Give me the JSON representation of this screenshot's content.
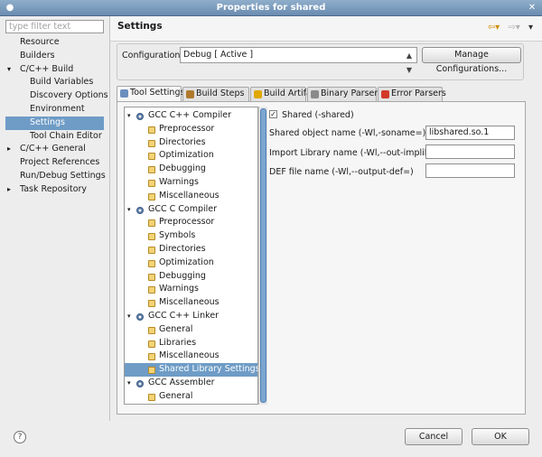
{
  "window": {
    "title": "Properties for shared"
  },
  "filter": {
    "placeholder": "type filter text"
  },
  "nav": {
    "items": [
      {
        "label": "Resource",
        "indent": 1,
        "arrow": ""
      },
      {
        "label": "Builders",
        "indent": 1,
        "arrow": ""
      },
      {
        "label": "C/C++ Build",
        "indent": 1,
        "arrow": "▾"
      },
      {
        "label": "Build Variables",
        "indent": 2,
        "arrow": ""
      },
      {
        "label": "Discovery Options",
        "indent": 2,
        "arrow": ""
      },
      {
        "label": "Environment",
        "indent": 2,
        "arrow": ""
      },
      {
        "label": "Settings",
        "indent": 2,
        "arrow": "",
        "selected": true
      },
      {
        "label": "Tool Chain Editor",
        "indent": 2,
        "arrow": ""
      },
      {
        "label": "C/C++ General",
        "indent": 1,
        "arrow": "▸"
      },
      {
        "label": "Project References",
        "indent": 1,
        "arrow": ""
      },
      {
        "label": "Run/Debug Settings",
        "indent": 1,
        "arrow": ""
      },
      {
        "label": "Task Repository",
        "indent": 1,
        "arrow": "▸"
      }
    ]
  },
  "header": {
    "title": "Settings",
    "back_icon": "⇦▾",
    "forward_icon": "⇨▾",
    "menu_icon": "▾"
  },
  "configuration": {
    "label": "Configuration:",
    "value": "Debug  [ Active ]",
    "manage_label": "Manage Configurations..."
  },
  "tabs": [
    {
      "label": "Tool Settings",
      "color": "#6b8fbd",
      "active": true
    },
    {
      "label": "Build Steps",
      "color": "#b0782c"
    },
    {
      "label": "Build Artifact",
      "color": "#e0a800"
    },
    {
      "label": "Binary Parsers",
      "color": "#8a8a8a"
    },
    {
      "label": "Error Parsers",
      "color": "#d23a2a"
    }
  ],
  "tree": {
    "items": [
      {
        "label": "GCC C++ Compiler",
        "type": "tool"
      },
      {
        "label": "Preprocessor",
        "type": "opt"
      },
      {
        "label": "Directories",
        "type": "opt"
      },
      {
        "label": "Optimization",
        "type": "opt"
      },
      {
        "label": "Debugging",
        "type": "opt"
      },
      {
        "label": "Warnings",
        "type": "opt"
      },
      {
        "label": "Miscellaneous",
        "type": "opt"
      },
      {
        "label": "GCC C Compiler",
        "type": "tool"
      },
      {
        "label": "Preprocessor",
        "type": "opt"
      },
      {
        "label": "Symbols",
        "type": "opt"
      },
      {
        "label": "Directories",
        "type": "opt"
      },
      {
        "label": "Optimization",
        "type": "opt"
      },
      {
        "label": "Debugging",
        "type": "opt"
      },
      {
        "label": "Warnings",
        "type": "opt"
      },
      {
        "label": "Miscellaneous",
        "type": "opt"
      },
      {
        "label": "GCC C++ Linker",
        "type": "tool"
      },
      {
        "label": "General",
        "type": "opt"
      },
      {
        "label": "Libraries",
        "type": "opt"
      },
      {
        "label": "Miscellaneous",
        "type": "opt"
      },
      {
        "label": "Shared Library Settings",
        "type": "opt",
        "selected": true
      },
      {
        "label": "GCC Assembler",
        "type": "tool"
      },
      {
        "label": "General",
        "type": "opt"
      }
    ]
  },
  "shared": {
    "checkbox_label": "Shared (-shared)",
    "checked": true,
    "fields": [
      {
        "label": "Shared object name (-Wl,-soname=)",
        "value": "libshared.so.1"
      },
      {
        "label": "Import Library name (-Wl,--out-implib=)",
        "value": ""
      },
      {
        "label": "DEF file name (-Wl,--output-def=)",
        "value": ""
      }
    ]
  },
  "buttons": {
    "help": "?",
    "cancel": "Cancel",
    "ok": "OK"
  }
}
